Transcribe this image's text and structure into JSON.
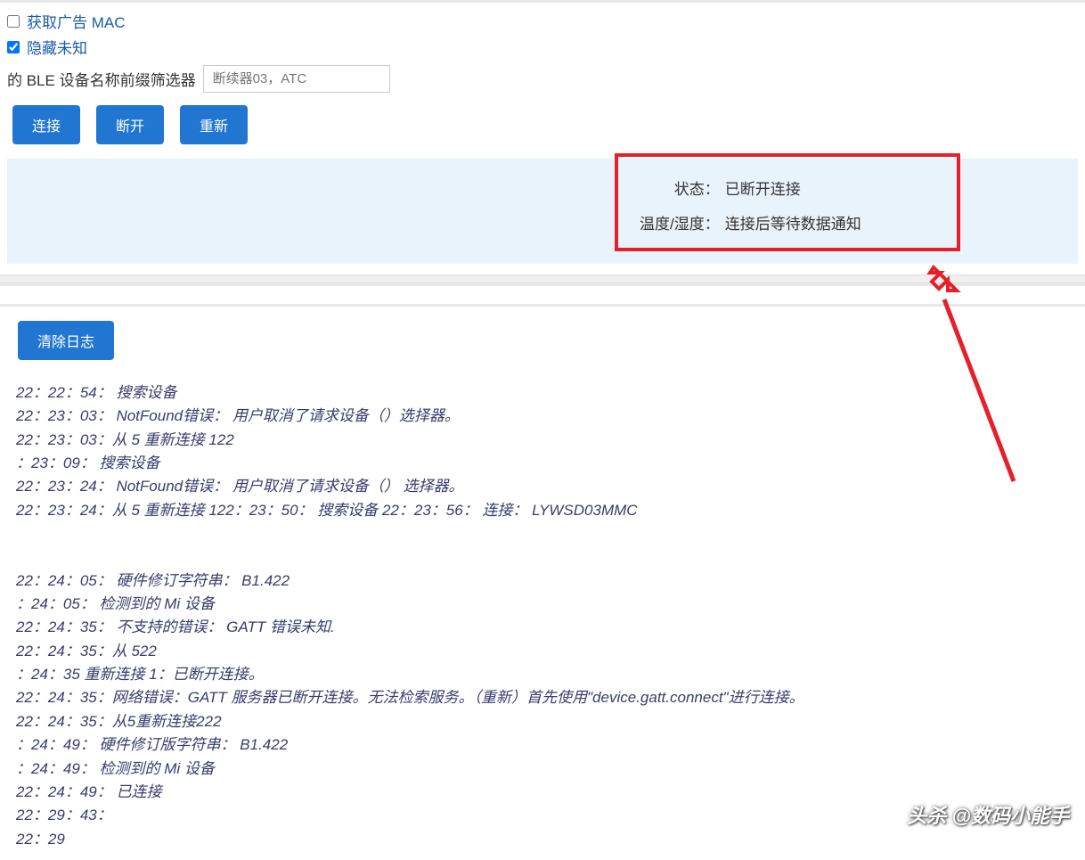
{
  "controls": {
    "get_adv_mac": {
      "label": "获取广告 MAC",
      "checked": false
    },
    "hide_unknown": {
      "label": "隐藏未知",
      "checked": true
    },
    "filter_label": "的 BLE 设备名称前缀筛选器",
    "filter_placeholder": "断续器03，ATC",
    "buttons": {
      "connect": "连接",
      "disconnect": "断开",
      "refresh": "重新"
    }
  },
  "status": {
    "state_label": "状态：",
    "state_value": "已断开连接",
    "temp_label": "温度/湿度：",
    "temp_value": "连接后等待数据通知"
  },
  "log": {
    "clear_button": "清除日志",
    "lines": [
      "22：22：54： 搜索设备",
      "22：23：03： NotFound错误： 用户取消了请求设备（）选择器。",
      "22：23：03：从 5 重新连接 122",
      "：23：09： 搜索设备",
      "22：23：24： NotFound错误： 用户取消了请求设备（） 选择器。",
      "22：23：24：从 5 重新连接 122：23：50： 搜索设备 22：23：56： 连接： LYWSD03MMC",
      "",
      "",
      "22：24：05： 硬件修订字符串： B1.422",
      "：24：05： 检测到的 Mi 设备",
      "22：24：35： 不支持的错误： GATT 错误未知.",
      "22：24：35：从 522",
      "：24：35 重新连接 1：已断开连接。",
      "22：24：35：网络错误：GATT 服务器已断开连接。无法检索服务。（重新）首先使用\"device.gatt.connect\"进行连接。",
      "22：24：35：从5重新连接222",
      "：24：49： 硬件修订版字符串： B1.422",
      "：24：49： 检测到的 Mi 设备",
      "22：24：49： 已连接",
      "22：29：43：",
      "22：29"
    ]
  },
  "annotation": {
    "highlight_color": "#e6202a"
  },
  "watermark": "头杀 @数码小能手"
}
